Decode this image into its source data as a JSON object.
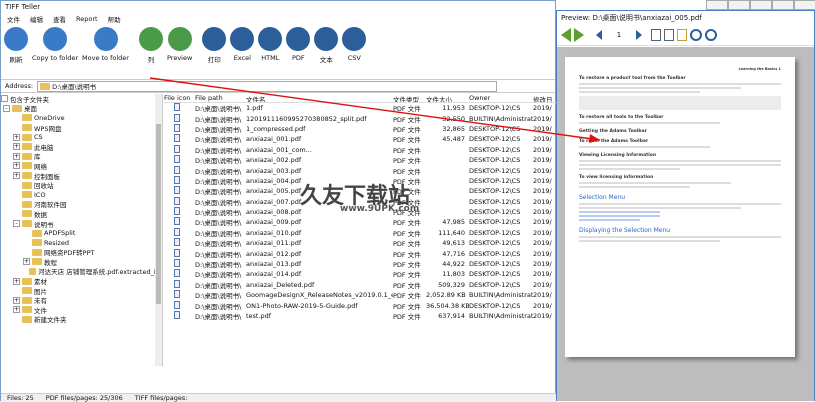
{
  "left_title": "TIFF Teller",
  "menu": [
    "文件",
    "编辑",
    "查看",
    "Report",
    "帮助"
  ],
  "toolbar": [
    {
      "label": "刷新",
      "color": "#3a7bc8",
      "name": "refresh-button"
    },
    {
      "label": "Copy to folder",
      "color": "#3a7bc8",
      "name": "copy-to-folder-button"
    },
    {
      "label": "Move to folder",
      "color": "#3a7bc8",
      "name": "move-to-folder-button"
    },
    {
      "label": "列",
      "color": "#4a9a4a",
      "name": "columns-button"
    },
    {
      "label": "Preview",
      "color": "#4a9a4a",
      "name": "preview-button"
    },
    {
      "label": "打印",
      "color": "#2c5f9a",
      "name": "print-button"
    },
    {
      "label": "Excel",
      "color": "#2c5f9a",
      "name": "excel-button"
    },
    {
      "label": "HTML",
      "color": "#2c5f9a",
      "name": "html-button"
    },
    {
      "label": "PDF",
      "color": "#2c5f9a",
      "name": "pdf-button"
    },
    {
      "label": "文本",
      "color": "#2c5f9a",
      "name": "text-button"
    },
    {
      "label": "CSV",
      "color": "#2c5f9a",
      "name": "csv-button"
    }
  ],
  "address_label": "Address:",
  "address_value": "D:\\桌面\\说明书",
  "tree_header": "包含子文件夹",
  "tree": [
    {
      "label": "桌面",
      "indent": 0,
      "tog": "-"
    },
    {
      "label": "OneDrive",
      "indent": 1,
      "tog": ""
    },
    {
      "label": "WPS网盘",
      "indent": 1,
      "tog": ""
    },
    {
      "label": "CS",
      "indent": 1,
      "tog": "+"
    },
    {
      "label": "此电脑",
      "indent": 1,
      "tog": "+"
    },
    {
      "label": "库",
      "indent": 1,
      "tog": "+"
    },
    {
      "label": "网络",
      "indent": 1,
      "tog": "+"
    },
    {
      "label": "控制面板",
      "indent": 1,
      "tog": "+"
    },
    {
      "label": "回收站",
      "indent": 1,
      "tog": ""
    },
    {
      "label": "ICO",
      "indent": 1,
      "tog": ""
    },
    {
      "label": "河南软件园",
      "indent": 1,
      "tog": ""
    },
    {
      "label": "数据",
      "indent": 1,
      "tog": ""
    },
    {
      "label": "说明书",
      "indent": 1,
      "tog": "-"
    },
    {
      "label": "APDFSplit",
      "indent": 2,
      "tog": ""
    },
    {
      "label": "Resized",
      "indent": 2,
      "tog": ""
    },
    {
      "label": "网络资PDF转PPT",
      "indent": 2,
      "tog": ""
    },
    {
      "label": "教程",
      "indent": 2,
      "tog": "+"
    },
    {
      "label": "河达天店 店铺管理系统.pdf.extracted_im",
      "indent": 2,
      "tog": ""
    },
    {
      "label": "素材",
      "indent": 1,
      "tog": "+"
    },
    {
      "label": "图片",
      "indent": 1,
      "tog": ""
    },
    {
      "label": "未有",
      "indent": 1,
      "tog": "+"
    },
    {
      "label": "文件",
      "indent": 1,
      "tog": "+"
    },
    {
      "label": "新建文件夹",
      "indent": 1,
      "tog": ""
    }
  ],
  "columns": [
    "File icon",
    "File path",
    "文件名",
    "文件类型",
    "文件大小",
    "Owner",
    "修改日"
  ],
  "rows": [
    [
      "D:\\桌面\\说明书\\",
      "1.pdf",
      "PDF 文件",
      "11,953",
      "DESKTOP-12\\CS",
      "2019/"
    ],
    [
      "D:\\桌面\\说明书\\",
      "1201911160995270380852_split.pdf",
      "PDF 文件",
      "32,550",
      "BUILTIN\\Administrators",
      "2019/"
    ],
    [
      "D:\\桌面\\说明书\\",
      "1_compressed.pdf",
      "PDF 文件",
      "32,865",
      "DESKTOP-12\\CS",
      "2019/"
    ],
    [
      "D:\\桌面\\说明书\\",
      "anxiazai_001.pdf",
      "PDF 文件",
      "45,487",
      "DESKTOP-12\\CS",
      "2019/"
    ],
    [
      "D:\\桌面\\说明书\\",
      "anxiazai_001_com...",
      "PDF 文件",
      "",
      "DESKTOP-12\\CS",
      "2019/"
    ],
    [
      "D:\\桌面\\说明书\\",
      "anxiazai_002.pdf",
      "PDF 文件",
      "",
      "DESKTOP-12\\CS",
      "2019/"
    ],
    [
      "D:\\桌面\\说明书\\",
      "anxiazai_003.pdf",
      "PDF 文件",
      "",
      "DESKTOP-12\\CS",
      "2019/"
    ],
    [
      "D:\\桌面\\说明书\\",
      "anxiazai_004.pdf",
      "PDF 文件",
      "",
      "DESKTOP-12\\CS",
      "2019/"
    ],
    [
      "D:\\桌面\\说明书\\",
      "anxiazai_005.pdf",
      "PDF 文件",
      "",
      "DESKTOP-12\\CS",
      "2019/"
    ],
    [
      "D:\\桌面\\说明书\\",
      "anxiazai_007.pdf",
      "PDF 文件",
      "",
      "DESKTOP-12\\CS",
      "2019/"
    ],
    [
      "D:\\桌面\\说明书\\",
      "anxiazai_008.pdf",
      "PDF 文件",
      "",
      "DESKTOP-12\\CS",
      "2019/"
    ],
    [
      "D:\\桌面\\说明书\\",
      "anxiazai_009.pdf",
      "PDF 文件",
      "47,985",
      "DESKTOP-12\\CS",
      "2019/"
    ],
    [
      "D:\\桌面\\说明书\\",
      "anxiazai_010.pdf",
      "PDF 文件",
      "111,640",
      "DESKTOP-12\\CS",
      "2019/"
    ],
    [
      "D:\\桌面\\说明书\\",
      "anxiazai_011.pdf",
      "PDF 文件",
      "49,613",
      "DESKTOP-12\\CS",
      "2019/"
    ],
    [
      "D:\\桌面\\说明书\\",
      "anxiazai_012.pdf",
      "PDF 文件",
      "47,716",
      "DESKTOP-12\\CS",
      "2019/"
    ],
    [
      "D:\\桌面\\说明书\\",
      "anxiazai_013.pdf",
      "PDF 文件",
      "44,922",
      "DESKTOP-12\\CS",
      "2019/"
    ],
    [
      "D:\\桌面\\说明书\\",
      "anxiazai_014.pdf",
      "PDF 文件",
      "11,803",
      "DESKTOP-12\\CS",
      "2019/"
    ],
    [
      "D:\\桌面\\说明书\\",
      "anxiazai_Deleted.pdf",
      "PDF 文件",
      "509,329",
      "DESKTOP-12\\CS",
      "2019/"
    ],
    [
      "D:\\桌面\\说明书\\",
      "GoomageDesignX_ReleaseNotes_v2019.0.1_en-th.pdf",
      "PDF 文件",
      "2,052.89 KB",
      "BUILTIN\\Administrators",
      "2019/"
    ],
    [
      "D:\\桌面\\说明书\\",
      "ON1-Photo-RAW-2019-5-Guide.pdf",
      "PDF 文件",
      "36,504.38 KB",
      "DESKTOP-12\\CS",
      "2019/"
    ],
    [
      "D:\\桌面\\说明书\\",
      "test.pdf",
      "PDF 文件",
      "637,914",
      "BUILTIN\\Administrators",
      "2019/"
    ]
  ],
  "status": [
    "Files:  25",
    "PDF files/pages:  25/306",
    "TIFF files/pages:"
  ],
  "preview_title": "Preview: D:\\桌面\\说明书\\anxiazai_005.pdf",
  "preview_page": "1",
  "doc": {
    "header": "Learning the Basics 1",
    "h1": "To restore a product tool from the Toolbar",
    "h2": "To restore all tools to the Toolbar",
    "h3": "Getting the Adams Toolbar",
    "h4": "To reset the Adams Toolbar",
    "h5": "Viewing Licensing Information",
    "h6": "To view licensing information",
    "sec1": "Selection Menu",
    "sec2": "Displaying the Selection Menu"
  },
  "watermark": "久友下载站",
  "watermark_url": "www.9UPK.com"
}
